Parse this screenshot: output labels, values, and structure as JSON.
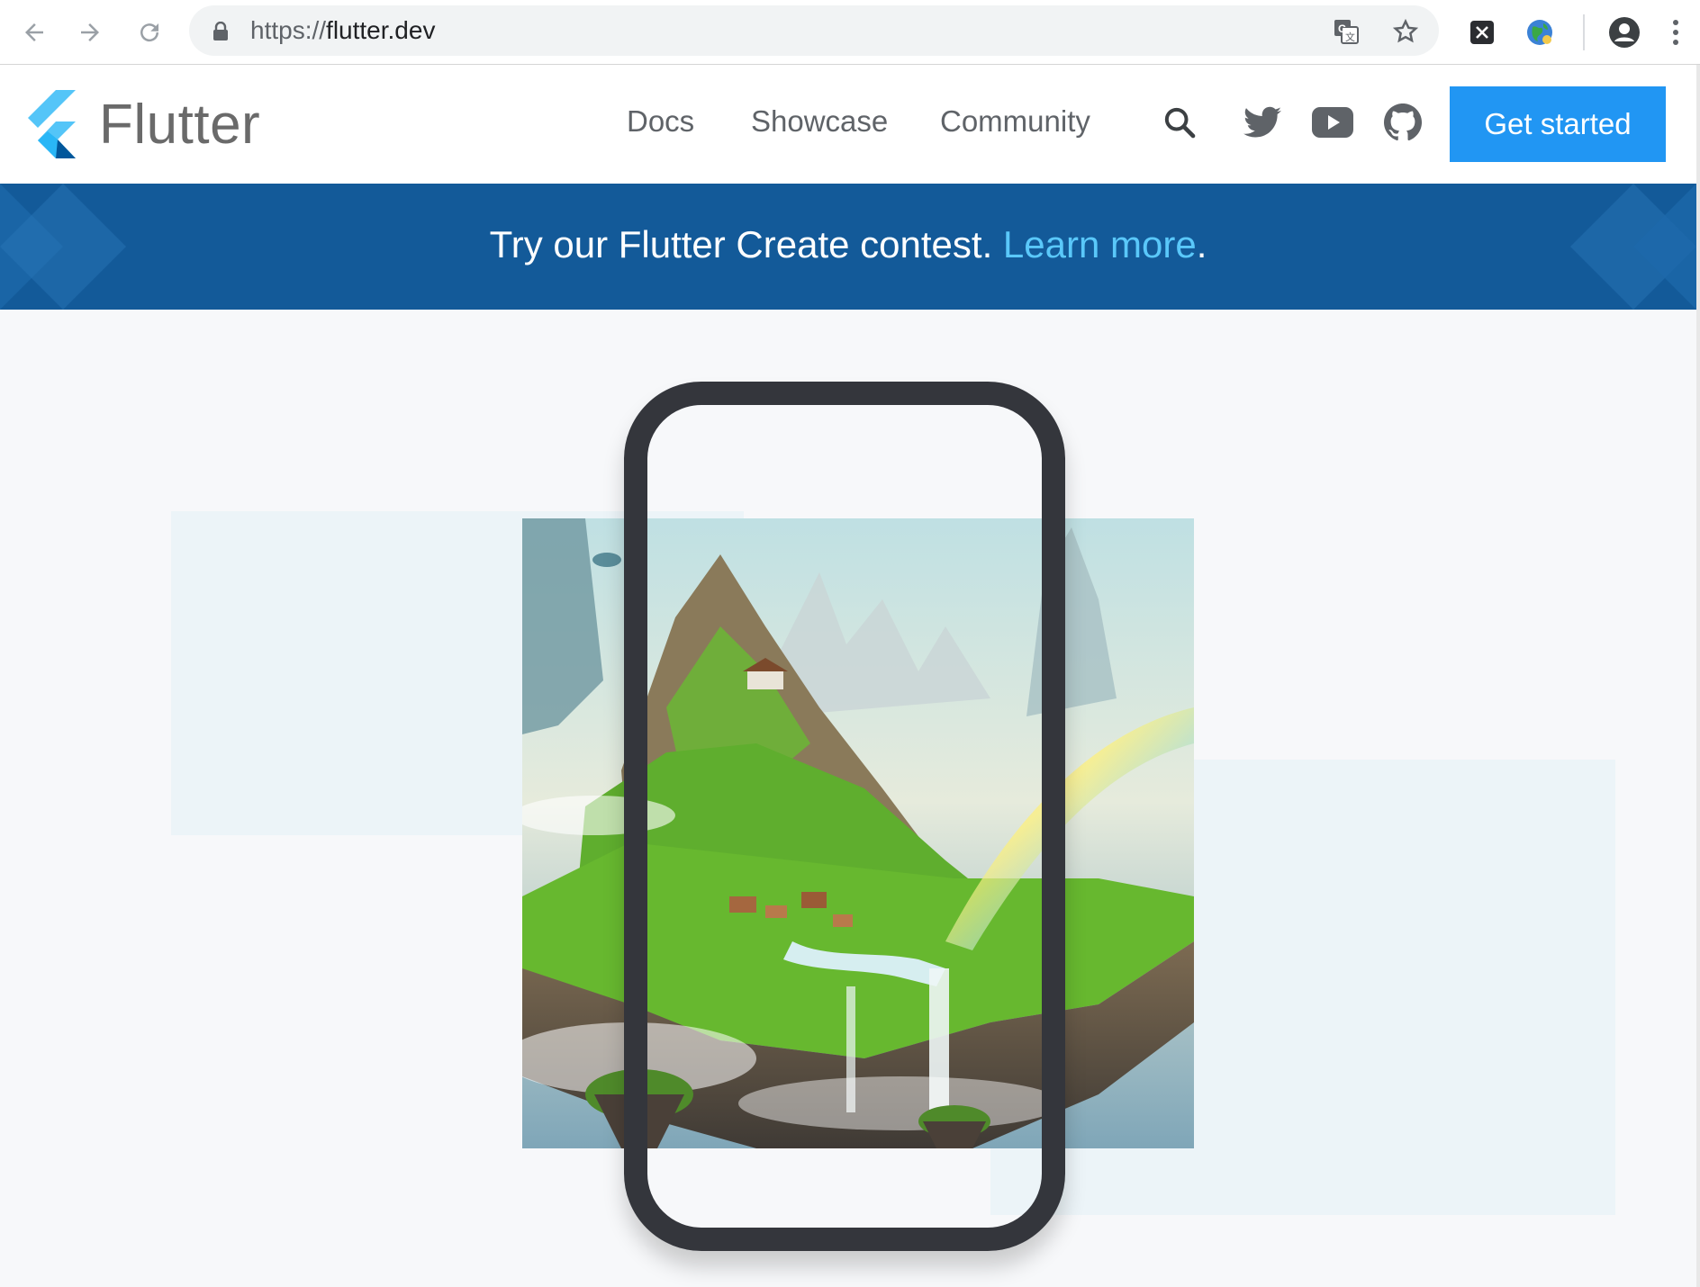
{
  "browser": {
    "url_scheme": "https://",
    "url_host": "flutter.dev",
    "icons": [
      "back-icon",
      "forward-icon",
      "reload-icon",
      "lock-icon",
      "translate-icon",
      "bookmark-star-icon",
      "extension-x-icon",
      "extension-globe-icon",
      "profile-icon",
      "menu-dots-icon"
    ]
  },
  "header": {
    "logo_text": "Flutter",
    "nav": [
      "Docs",
      "Showcase",
      "Community"
    ],
    "icons": [
      "search-icon",
      "twitter-icon",
      "youtube-icon",
      "github-icon"
    ],
    "cta_label": "Get started"
  },
  "banner": {
    "text": "Try our Flutter Create contest.",
    "link_text": "Learn more",
    "trailing": "."
  },
  "colors": {
    "brand_blue": "#2196f3",
    "banner_bg": "#135a99",
    "banner_link": "#5ac8fa",
    "phone_frame": "#34363c"
  }
}
